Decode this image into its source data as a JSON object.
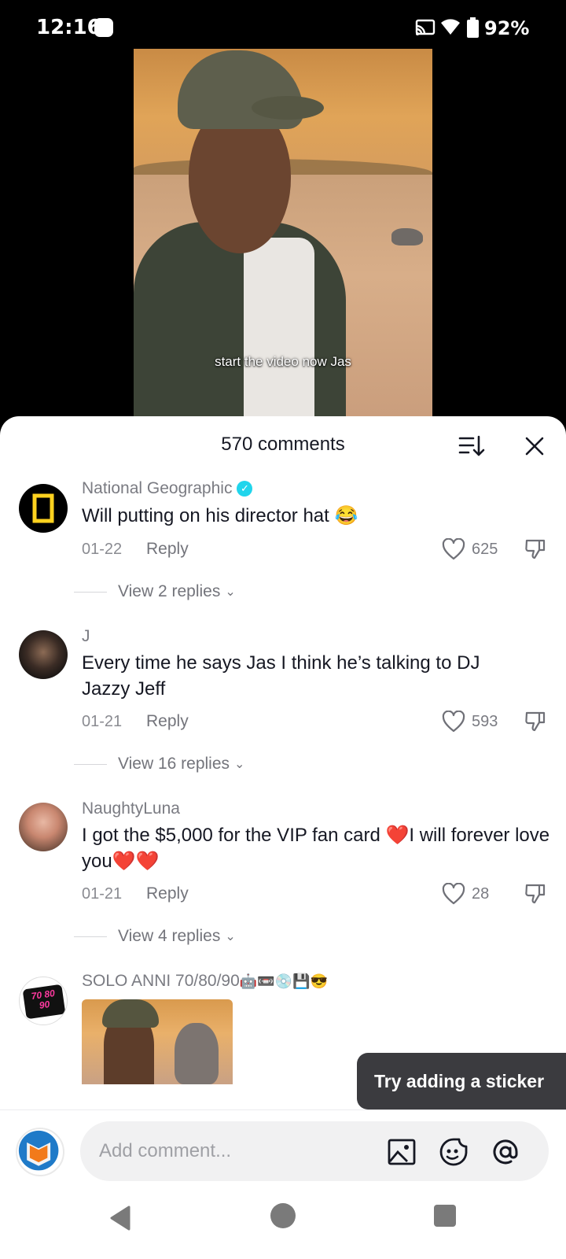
{
  "status_bar": {
    "time": "12:16",
    "battery": "92%"
  },
  "video": {
    "caption": "start the video now Jas"
  },
  "sheet": {
    "title": "570 comments"
  },
  "comments": [
    {
      "user": "National Geographic",
      "verified": true,
      "text": "Will putting on his director hat",
      "emoji": "😂",
      "date": "01-22",
      "reply_label": "Reply",
      "likes": "625",
      "view_replies": "View 2 replies"
    },
    {
      "user": "J",
      "text": "Every time he says Jas I think he’s talking to DJ Jazzy Jeff",
      "date": "01-21",
      "reply_label": "Reply",
      "likes": "593",
      "view_replies": "View 16 replies"
    },
    {
      "user": "NaughtyLuna",
      "text_part1": "I got the $5,000 for the VIP fan card ",
      "heart1": "❤️",
      "text_part2": "I will forever love you",
      "heart2": "❤️❤️",
      "date": "01-21",
      "reply_label": "Reply",
      "likes": "28",
      "view_replies": "View 4 replies"
    },
    {
      "user": "SOLO ANNI 70/80/90",
      "user_emoji": "🤖📼💿💾😎",
      "avatar_text": "70 80 90"
    }
  ],
  "tooltip": {
    "text": "Try adding a sticker"
  },
  "input": {
    "placeholder": "Add comment..."
  },
  "colors": {
    "verified": "#20d5ec",
    "heart": "#e81f2d",
    "natgeo_yellow": "#ffd21f"
  }
}
